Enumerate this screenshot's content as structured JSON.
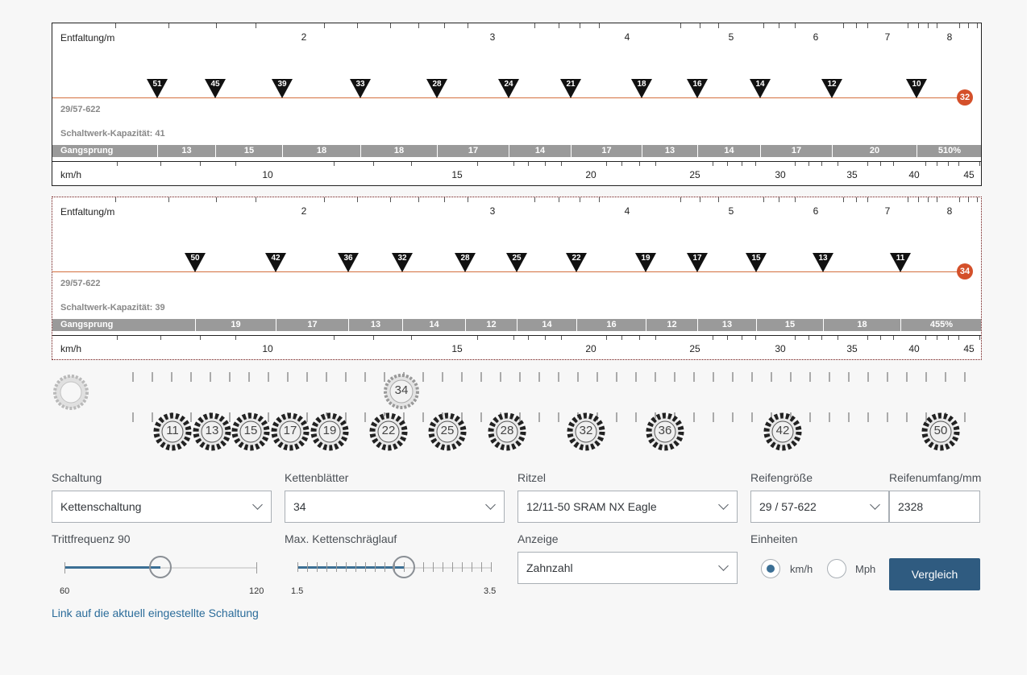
{
  "panels": [
    {
      "axis_title": "Entfaltung/m",
      "entfaltung_ticks": [
        "2",
        "3",
        "4",
        "5",
        "6",
        "7",
        "8"
      ],
      "ratio_label": "29/57-622",
      "capacity_label": "Schaltwerk-Kapazität: 41",
      "chainring": "32",
      "markers": [
        "51",
        "45",
        "39",
        "33",
        "28",
        "24",
        "21",
        "18",
        "16",
        "14",
        "12",
        "10"
      ],
      "gang_label": "Gangsprung",
      "gang_values": [
        "13",
        "15",
        "18",
        "18",
        "17",
        "14",
        "17",
        "13",
        "14",
        "17",
        "20",
        "510%"
      ],
      "speed_title": "km/h",
      "speed_ticks": [
        "10",
        "15",
        "20",
        "25",
        "30",
        "35",
        "40",
        "45"
      ]
    },
    {
      "axis_title": "Entfaltung/m",
      "entfaltung_ticks": [
        "2",
        "3",
        "4",
        "5",
        "6",
        "7",
        "8"
      ],
      "ratio_label": "29/57-622",
      "capacity_label": "Schaltwerk-Kapazität: 39",
      "chainring": "34",
      "markers": [
        "50",
        "42",
        "36",
        "32",
        "28",
        "25",
        "22",
        "19",
        "17",
        "15",
        "13",
        "11"
      ],
      "gang_label": "Gangsprung",
      "gang_values": [
        "19",
        "17",
        "13",
        "14",
        "12",
        "14",
        "16",
        "12",
        "13",
        "15",
        "18",
        "455%"
      ],
      "speed_title": "km/h",
      "speed_ticks": [
        "10",
        "15",
        "20",
        "25",
        "30",
        "35",
        "40",
        "45"
      ]
    }
  ],
  "cassette": {
    "chainring": "34",
    "cogs": [
      "11",
      "13",
      "15",
      "17",
      "19",
      "22",
      "25",
      "28",
      "32",
      "36",
      "42",
      "50"
    ]
  },
  "form": {
    "schaltung_label": "Schaltung",
    "schaltung_value": "Kettenschaltung",
    "kettenblaetter_label": "Kettenblätter",
    "kettenblaetter_value": "34",
    "ritzel_label": "Ritzel",
    "ritzel_value": "12/11-50 SRAM NX Eagle",
    "reifen_label": "Reifengröße",
    "reifen_value": "29 / 57-622",
    "umfang_label": "Reifenumfang/mm",
    "umfang_value": "2328",
    "trittfrequenz_label": "Trittfrequenz 90",
    "trittfrequenz_min": "60",
    "trittfrequenz_max": "120",
    "trittfrequenz_value": 90,
    "schraeglauf_label": "Max. Kettenschräglauf",
    "schraeglauf_min": "1.5",
    "schraeglauf_max": "3.5",
    "schraeglauf_value": 2.6,
    "anzeige_label": "Anzeige",
    "anzeige_value": "Zahnzahl",
    "einheiten_label": "Einheiten",
    "unit_kmh": "km/h",
    "unit_mph": "Mph",
    "unit_selected": "km/h",
    "compare_button": "Vergleich",
    "link_text": "Link auf die aktuell eingestellte Schaltung"
  }
}
